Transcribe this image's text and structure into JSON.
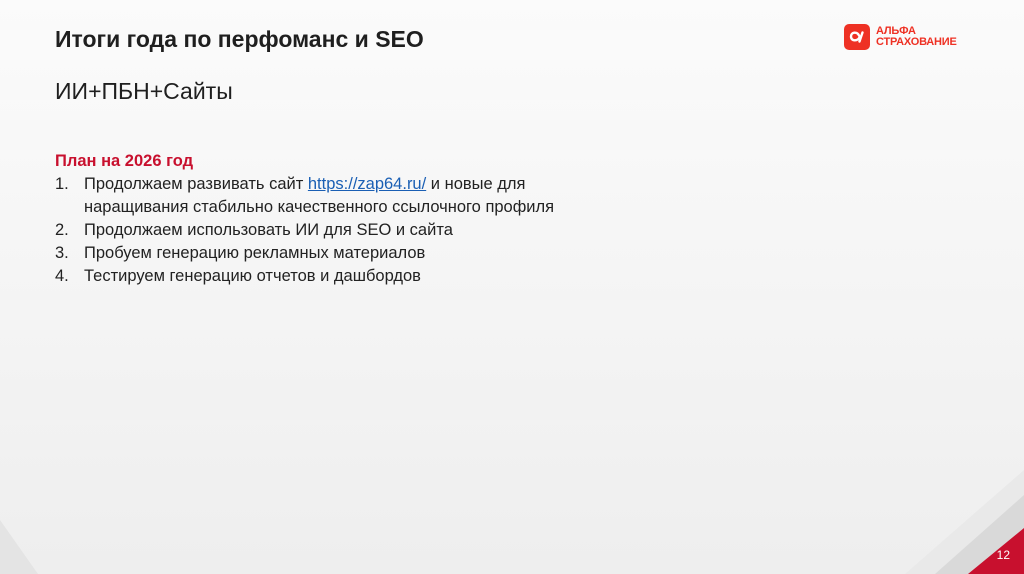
{
  "slide": {
    "title": "Итоги года по перфоманс и SEO",
    "subtitle": "ИИ+ПБН+Сайты",
    "page_number": "12"
  },
  "logo": {
    "symbol": "α",
    "line1": "АЛЬФА",
    "line2": "СТРАХОВАНИЕ",
    "color": "#ee3124"
  },
  "plan": {
    "heading": "План на 2026 год",
    "heading_color": "#c8102e",
    "link_color": "#1a5fb4",
    "items": [
      {
        "num": "1.",
        "text_before": "Продолжаем развивать сайт ",
        "link": "https://zap64.ru/",
        "text_after": " и новые для наращивания стабильно качественного ссылочного профиля"
      },
      {
        "num": "2.",
        "text": "Продолжаем использовать ИИ для SEO и сайта"
      },
      {
        "num": "3.",
        "text": "Пробуем генерацию рекламных материалов"
      },
      {
        "num": "4.",
        "text": "Тестируем генерацию отчетов и дашбордов"
      }
    ]
  }
}
